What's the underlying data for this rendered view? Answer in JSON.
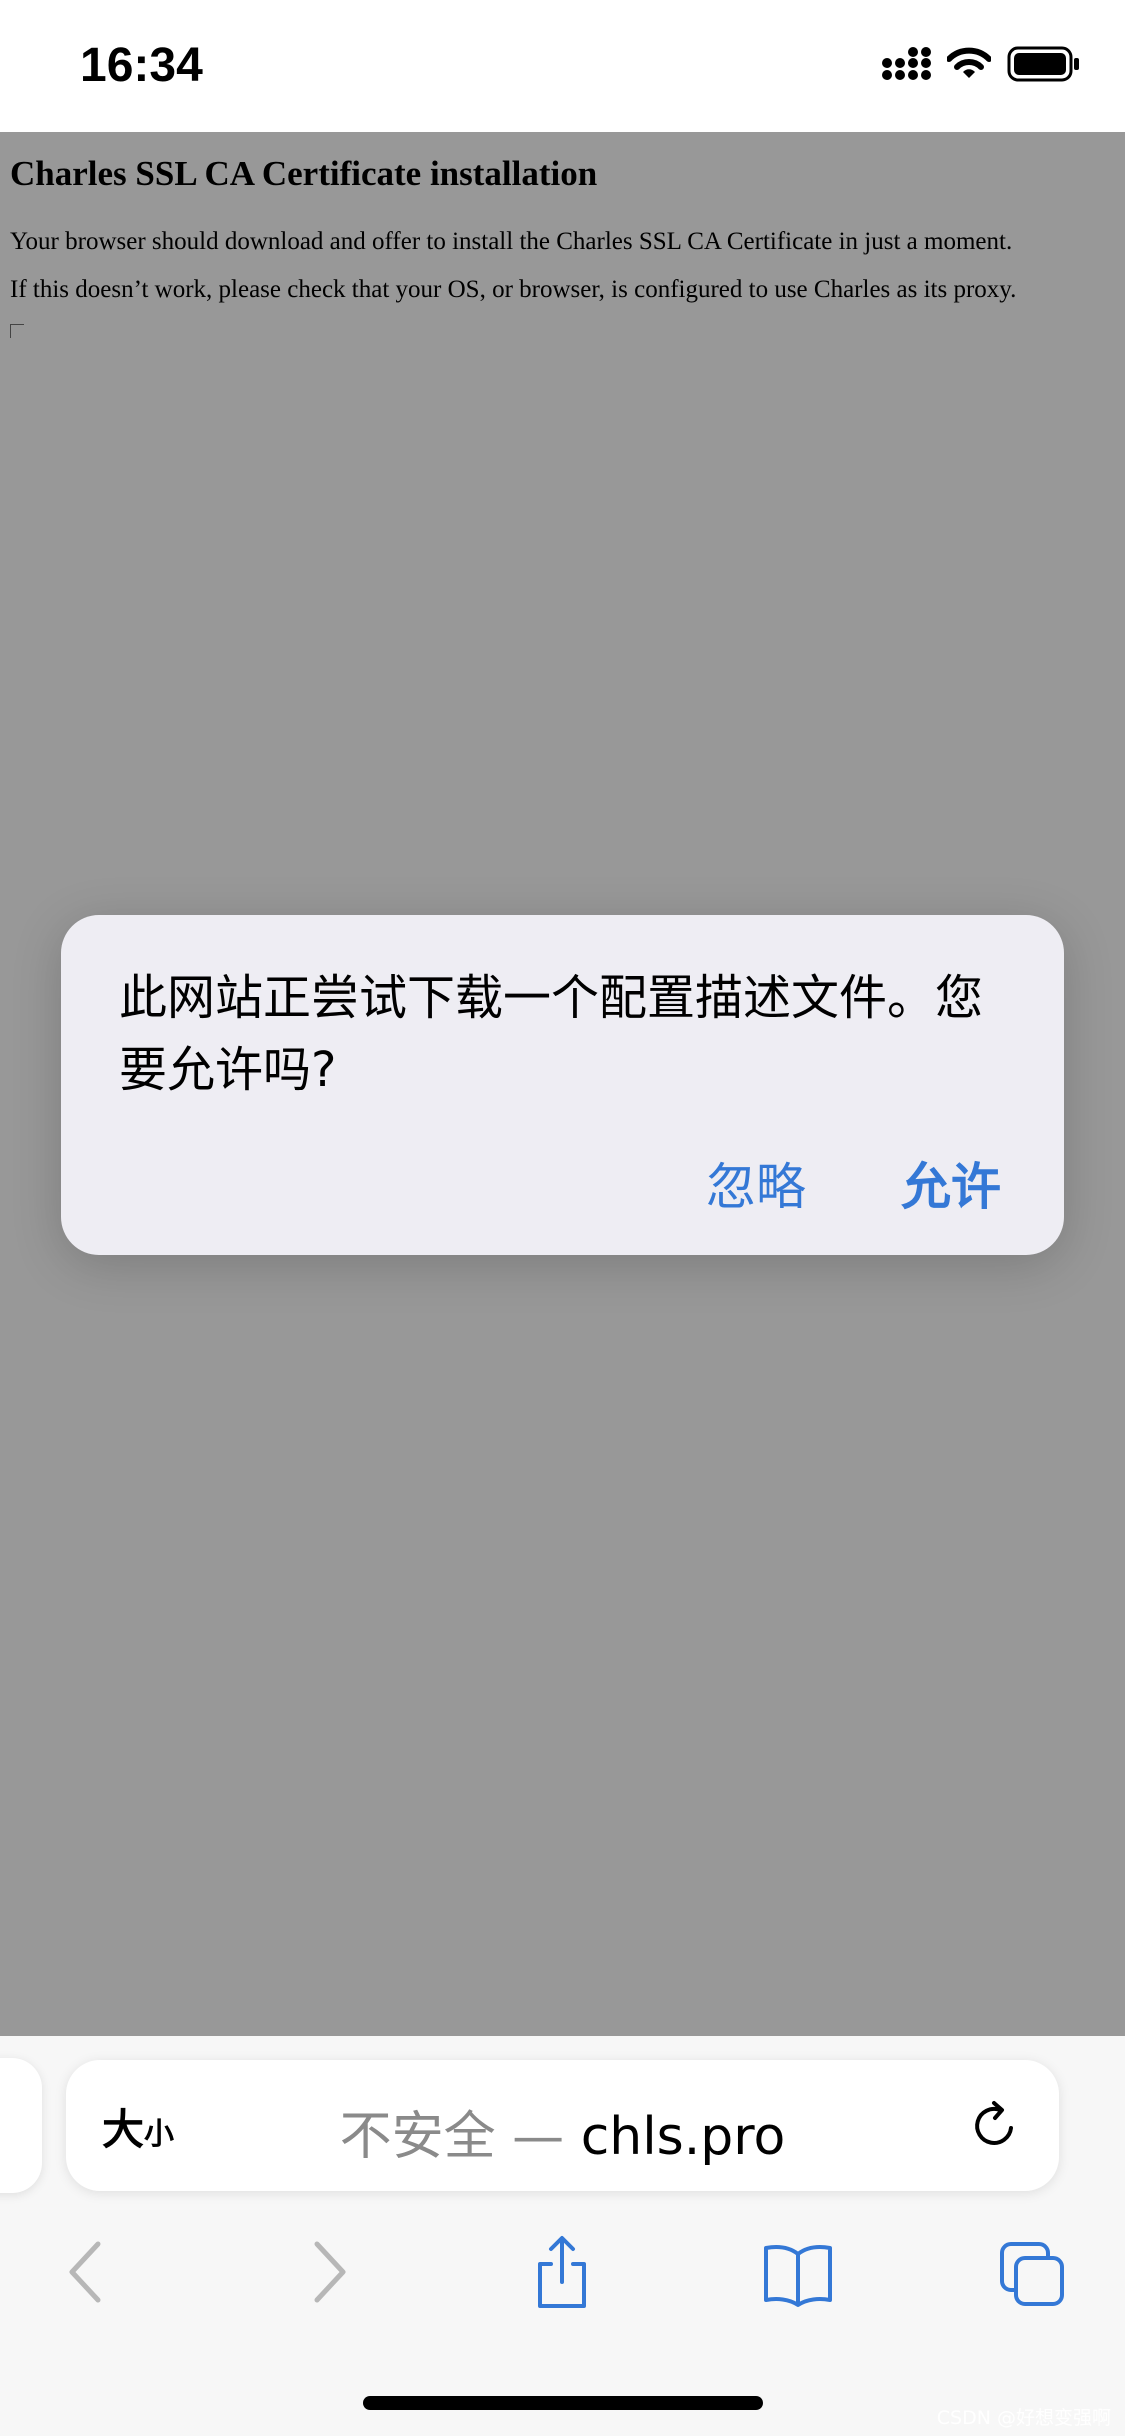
{
  "status_bar": {
    "time": "16:34"
  },
  "page": {
    "title": "Charles SSL CA Certificate installation",
    "paragraph_1": "Your browser should download and offer to install the Charles SSL CA Certificate in just a moment.",
    "paragraph_2": "If this doesn’t work, please check that your OS, or browser, is configured to use Charles as its proxy."
  },
  "alert": {
    "message": "此网站正尝试下载一个配置描述文件。您要允许吗?",
    "ignore_label": "忽略",
    "allow_label": "允许",
    "button_color": "#3478d6"
  },
  "address_bar": {
    "text_size_big": "大",
    "text_size_small": "小",
    "insecure_label": "不安全",
    "separator": " — ",
    "domain": "chls.pro"
  },
  "toolbar": {
    "icons": [
      "back-icon",
      "forward-icon",
      "share-icon",
      "bookmarks-icon",
      "tabs-icon"
    ]
  },
  "watermark": "CSDN @好想变强啊"
}
